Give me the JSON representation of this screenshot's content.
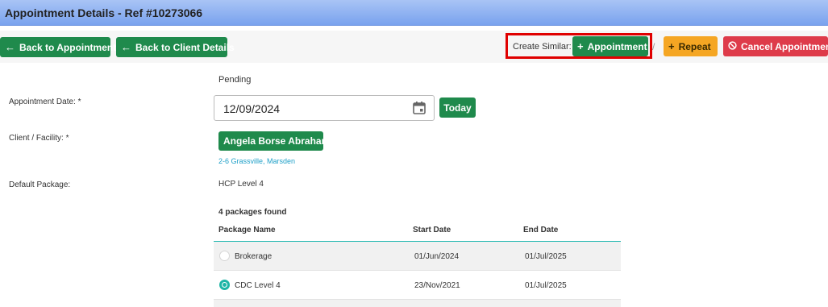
{
  "window": {
    "title": "Appointment Details - Ref #10273066"
  },
  "toolbar": {
    "back_appointments": "Back to Appointments",
    "back_client": "Back to Client Details",
    "create_similar_label": "Create Similar:",
    "appointment_button": "Appointment",
    "separator": "/",
    "repeat_button": "Repeat",
    "cancel_button": "Cancel Appointment"
  },
  "form": {
    "status": "Pending",
    "appointment_date_label": "Appointment Date: *",
    "appointment_date_value": "12/09/2024",
    "today_button": "Today",
    "client_label": "Client / Facility: *",
    "client_name": "Angela Borse Abraham",
    "client_address": "2-6 Grassville, Marsden",
    "default_package_label": "Default Package:",
    "default_package_value": "HCP Level 4"
  },
  "packages": {
    "count_text": "4 packages found",
    "headers": {
      "name": "Package Name",
      "start": "Start Date",
      "end": "End Date"
    },
    "rows": [
      {
        "name": "Brokerage",
        "start": "01/Jun/2024",
        "end": "01/Jul/2025",
        "selected": false
      },
      {
        "name": "CDC Level 4",
        "start": "23/Nov/2021",
        "end": "01/Jul/2025",
        "selected": true
      }
    ]
  },
  "colors": {
    "primary_green": "#1f8a4c",
    "warning_orange": "#f5a623",
    "danger_red": "#de3b4a",
    "highlight_red": "#e00000",
    "accent_teal": "#1fb5a6",
    "link_blue": "#1fa0c8"
  },
  "icons": {
    "back": "arrow-left-icon",
    "add": "plus-icon",
    "cancel": "ban-icon",
    "calendar": "calendar-icon"
  }
}
